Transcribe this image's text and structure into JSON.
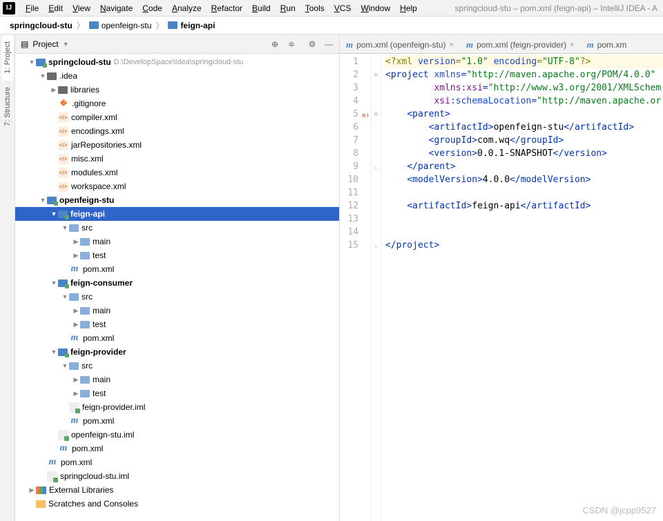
{
  "window_title": "springcloud-stu – pom.xml (feign-api) – IntelliJ IDEA - A",
  "menu": [
    "File",
    "Edit",
    "View",
    "Navigate",
    "Code",
    "Analyze",
    "Refactor",
    "Build",
    "Run",
    "Tools",
    "VCS",
    "Window",
    "Help"
  ],
  "breadcrumb": [
    "springcloud-stu",
    "openfeign-stu",
    "feign-api"
  ],
  "sidebar_tabs": {
    "project": "1: Project",
    "structure": "7: Structure"
  },
  "panel": {
    "title": "Project"
  },
  "tree": [
    {
      "d": 0,
      "a": "▼",
      "i": "module",
      "t": "springcloud-stu",
      "b": 1,
      "dim": "D:\\DevelopSpace\\Idea\\springcloud-stu"
    },
    {
      "d": 1,
      "a": "▼",
      "i": "folder dark",
      "t": ".idea"
    },
    {
      "d": 2,
      "a": "▶",
      "i": "folder dark",
      "t": "libraries"
    },
    {
      "d": 2,
      "a": "",
      "i": "git",
      "t": ".gitignore"
    },
    {
      "d": 2,
      "a": "",
      "i": "xml",
      "t": "compiler.xml"
    },
    {
      "d": 2,
      "a": "",
      "i": "xml",
      "t": "encodings.xml"
    },
    {
      "d": 2,
      "a": "",
      "i": "xml",
      "t": "jarRepositories.xml"
    },
    {
      "d": 2,
      "a": "",
      "i": "xml",
      "t": "misc.xml"
    },
    {
      "d": 2,
      "a": "",
      "i": "xml",
      "t": "modules.xml"
    },
    {
      "d": 2,
      "a": "",
      "i": "xml",
      "t": "workspace.xml"
    },
    {
      "d": 1,
      "a": "▼",
      "i": "module",
      "t": "openfeign-stu",
      "b": 1
    },
    {
      "d": 2,
      "a": "▼",
      "i": "module",
      "t": "feign-api",
      "b": 1,
      "sel": 1
    },
    {
      "d": 3,
      "a": "▼",
      "i": "folder",
      "t": "src"
    },
    {
      "d": 4,
      "a": "▶",
      "i": "folder",
      "t": "main"
    },
    {
      "d": 4,
      "a": "▶",
      "i": "folder",
      "t": "test"
    },
    {
      "d": 3,
      "a": "",
      "i": "m",
      "t": "pom.xml"
    },
    {
      "d": 2,
      "a": "▼",
      "i": "module",
      "t": "feign-consumer",
      "b": 1
    },
    {
      "d": 3,
      "a": "▼",
      "i": "folder",
      "t": "src"
    },
    {
      "d": 4,
      "a": "▶",
      "i": "folder",
      "t": "main"
    },
    {
      "d": 4,
      "a": "▶",
      "i": "folder",
      "t": "test"
    },
    {
      "d": 3,
      "a": "",
      "i": "m",
      "t": "pom.xml"
    },
    {
      "d": 2,
      "a": "▼",
      "i": "module",
      "t": "feign-provider",
      "b": 1
    },
    {
      "d": 3,
      "a": "▼",
      "i": "folder",
      "t": "src"
    },
    {
      "d": 4,
      "a": "▶",
      "i": "folder",
      "t": "main"
    },
    {
      "d": 4,
      "a": "▶",
      "i": "folder",
      "t": "test"
    },
    {
      "d": 3,
      "a": "",
      "i": "iml",
      "t": "feign-provider.iml"
    },
    {
      "d": 3,
      "a": "",
      "i": "m",
      "t": "pom.xml"
    },
    {
      "d": 2,
      "a": "",
      "i": "iml",
      "t": "openfeign-stu.iml"
    },
    {
      "d": 2,
      "a": "",
      "i": "m",
      "t": "pom.xml"
    },
    {
      "d": 1,
      "a": "",
      "i": "m",
      "t": "pom.xml"
    },
    {
      "d": 1,
      "a": "",
      "i": "iml",
      "t": "springcloud-stu.iml"
    },
    {
      "d": 0,
      "a": "▶",
      "i": "lib",
      "t": "External Libraries"
    },
    {
      "d": 0,
      "a": "",
      "i": "scratch",
      "t": "Scratches and Consoles"
    }
  ],
  "editor_tabs": [
    {
      "label": "pom.xml (openfeign-stu)"
    },
    {
      "label": "pom.xml (feign-provider)"
    },
    {
      "label": "pom.xm"
    }
  ],
  "code": {
    "lines": 15,
    "marker_line": 5,
    "l1": {
      "pre": "<?",
      "xml": "xml ",
      "ver_k": "version",
      "eq": "=",
      "ver_v": "\"1.0\"",
      "sp": " ",
      "enc_k": "encoding",
      "enc_v": "\"UTF-8\"",
      "post": "?>"
    },
    "l2": {
      "open": "<",
      "tag": "project ",
      "attr": "xmlns",
      "eq": "=",
      "val": "\"http://maven.apache.org/POM/4.0.0\""
    },
    "l3": {
      "pad": "         ",
      "ns": "xmlns:xsi",
      "eq": "=",
      "val": "\"http://www.w3.org/2001/XMLSchem"
    },
    "l4": {
      "pad": "         ",
      "ns": "xsi",
      "attr": ":schemaLocation",
      "eq": "=",
      "val": "\"http://maven.apache.or"
    },
    "l5": {
      "pad": "    ",
      "o": "<",
      "t": "parent",
      "c": ">"
    },
    "l6": {
      "pad": "        ",
      "o": "<",
      "t": "artifactId",
      "c": ">",
      "txt": "openfeign-stu",
      "o2": "</",
      "c2": ">"
    },
    "l7": {
      "pad": "        ",
      "o": "<",
      "t": "groupId",
      "c": ">",
      "txt": "com.wq",
      "o2": "</",
      "c2": ">"
    },
    "l8": {
      "pad": "        ",
      "o": "<",
      "t": "version",
      "c": ">",
      "txt": "0.0.1-SNAPSHOT",
      "o2": "</",
      "c2": ">"
    },
    "l9": {
      "pad": "    ",
      "o": "</",
      "t": "parent",
      "c": ">"
    },
    "l10": {
      "pad": "    ",
      "o": "<",
      "t": "modelVersion",
      "c": ">",
      "txt": "4.0.0",
      "o2": "</",
      "c2": ">"
    },
    "l12": {
      "pad": "    ",
      "o": "<",
      "t": "artifactId",
      "c": ">",
      "txt": "feign-api",
      "o2": "</",
      "c2": ">"
    },
    "l15": {
      "o": "</",
      "t": "project",
      "c": ">"
    }
  },
  "watermark": "CSDN @jcpp9527"
}
